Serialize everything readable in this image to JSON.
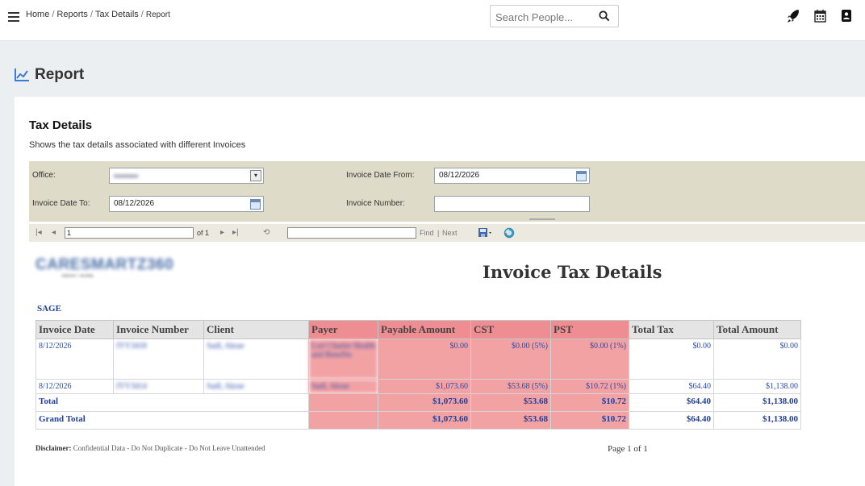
{
  "breadcrumb": {
    "home": "Home",
    "sep": "/",
    "reports": "Reports",
    "tax_details": "Tax Details",
    "current": "Report"
  },
  "search": {
    "placeholder": "Search People..."
  },
  "icons": {
    "menu": "hamburger-icon",
    "search": "magnifier-icon",
    "rocket": "rocket-icon",
    "calendar": "calendar-icon",
    "profile": "profile-icon",
    "report": "chart-line-icon"
  },
  "page": {
    "title": "Report"
  },
  "section": {
    "title": "Tax Details",
    "description": "Shows the tax details associated with different Invoices"
  },
  "params": {
    "office_label": "Office:",
    "office_value": "▬▬▬",
    "date_from_label": "Invoice Date From:",
    "date_from_value": "08/12/2026",
    "date_to_label": "Invoice Date To:",
    "date_to_value": "08/12/2026",
    "invoice_number_label": "Invoice Number:",
    "invoice_number_value": ""
  },
  "toolbar": {
    "page_value": "1",
    "of_label": "of 1",
    "find_label": "Find",
    "find_sep": "|",
    "next_label": "Next"
  },
  "report": {
    "logo_text": "CARESMARTZ360",
    "logo_sub": "SMART HOME",
    "title": "Invoice Tax Details",
    "office_name": "SAGE",
    "headers": [
      "Invoice Date",
      "Invoice Number",
      "Client",
      "Payer",
      "Payable Amount",
      "CST",
      "PST",
      "Total Tax",
      "Total Amount"
    ],
    "rows": [
      {
        "date": "8/12/2026",
        "number": "IYY3418",
        "client": "Sadl, Akrae",
        "payer": "Lori Charter Health and Benefits",
        "payable": "$0.00",
        "cst": "$0.00 (5%)",
        "pst": "$0.00 (1%)",
        "total_tax": "$0.00",
        "total_amount": "$0.00"
      },
      {
        "date": "8/12/2026",
        "number": "IYY3414",
        "client": "Sadl, Akrae",
        "payer": "Sadl, Akrae",
        "payable": "$1,073.60",
        "cst": "$53.68 (5%)",
        "pst": "$10.72 (1%)",
        "total_tax": "$64.40",
        "total_amount": "$1,138.00"
      }
    ],
    "total": {
      "label": "Total",
      "payable": "$1,073.60",
      "cst": "$53.68",
      "pst": "$10.72",
      "total_tax": "$64.40",
      "total_amount": "$1,138.00"
    },
    "grand_total": {
      "label": "Grand Total",
      "payable": "$1,073.60",
      "cst": "$53.68",
      "pst": "$10.72",
      "total_tax": "$64.40",
      "total_amount": "$1,138.00"
    },
    "disclaimer_label": "Disclaimer:",
    "disclaimer_text": "Confidential Data - Do Not Duplicate - Do Not Leave Unattended",
    "page_info": "Page 1 of 1"
  },
  "colors": {
    "highlight": "#f3a2a4",
    "link_blue": "#2a4aa8",
    "param_bg": "#dedbc8"
  }
}
